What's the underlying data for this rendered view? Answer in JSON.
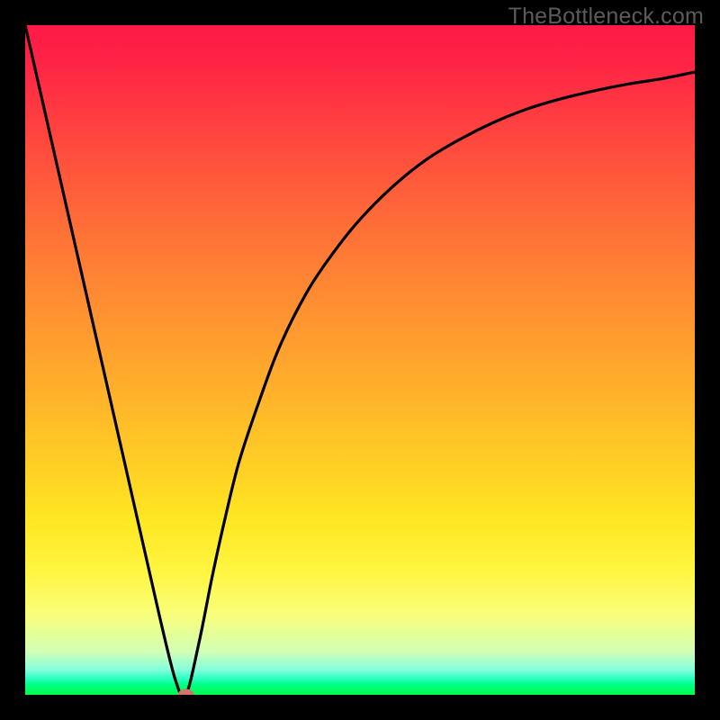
{
  "watermark": "TheBottleneck.com",
  "chart_data": {
    "type": "line",
    "title": "",
    "xlabel": "",
    "ylabel": "",
    "xlim": [
      0,
      100
    ],
    "ylim": [
      0,
      100
    ],
    "grid": false,
    "series": [
      {
        "name": "curve",
        "x": [
          0,
          5,
          10,
          15,
          20,
          22.5,
          24,
          26,
          28,
          30,
          32,
          35,
          38,
          42,
          46,
          50,
          55,
          60,
          65,
          70,
          75,
          80,
          85,
          90,
          95,
          100
        ],
        "values": [
          100,
          78,
          56,
          34,
          12,
          2,
          0,
          8,
          18,
          27,
          35,
          44,
          52,
          60,
          66,
          71,
          76,
          80,
          83,
          85.5,
          87.5,
          89,
          90.2,
          91.2,
          92,
          93
        ]
      }
    ],
    "marker": {
      "x": 24,
      "y": 0,
      "color": "#d0746c"
    },
    "colors": {
      "curve": "#000000",
      "background_top": "#ff1848",
      "background_bottom": "#00ff4a",
      "frame": "#000000"
    }
  }
}
